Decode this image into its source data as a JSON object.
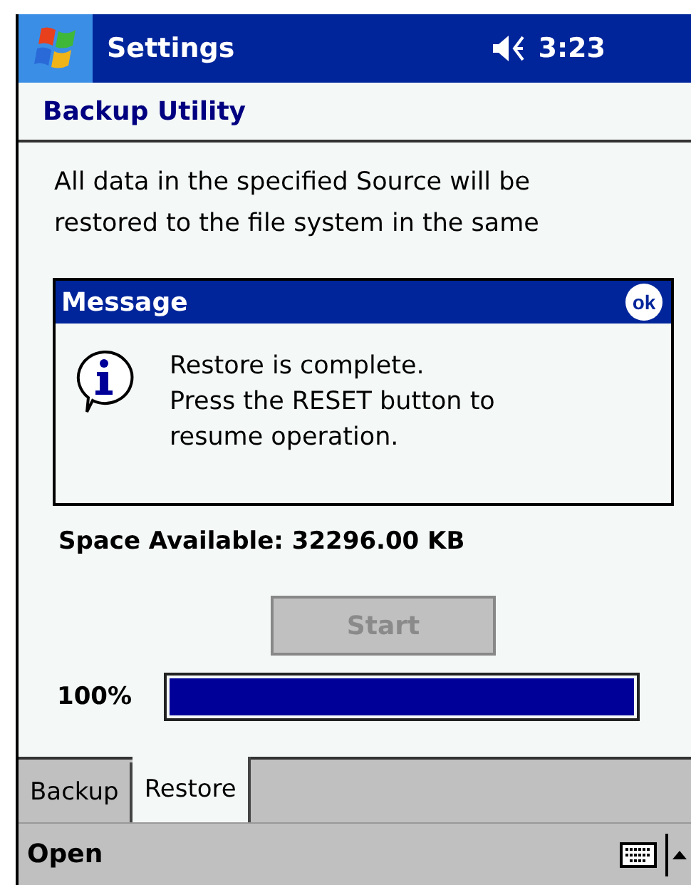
{
  "title_bar": {
    "title": "Settings",
    "time": "3:23"
  },
  "header": {
    "title": "Backup Utility"
  },
  "description": [
    "All data in the specified Source will be",
    "restored to the file system in the same"
  ],
  "message": {
    "title": "Message",
    "ok": "ok",
    "text": [
      "Restore is complete.",
      "Press the RESET button to",
      "resume operation."
    ]
  },
  "space_available": "Space Available: 32296.00 KB",
  "start_button": {
    "label": "Start",
    "disabled": true
  },
  "progress": {
    "label": "100%",
    "level": 1
  },
  "tabs": [
    {
      "label": "Backup",
      "selected": false
    },
    {
      "label": "Restore",
      "selected": true
    }
  ],
  "menu_bar": {
    "items": [
      "Open"
    ]
  }
}
